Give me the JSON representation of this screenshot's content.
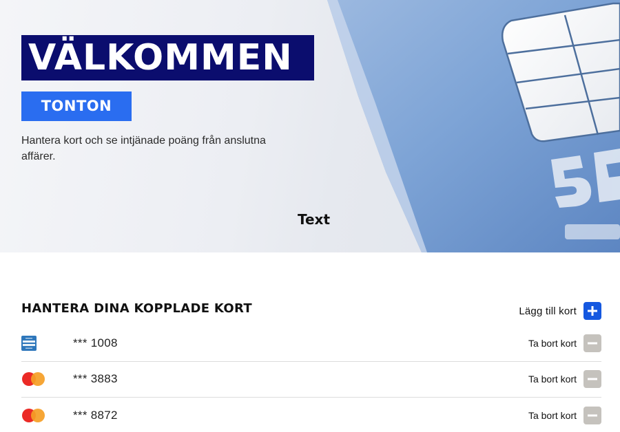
{
  "hero": {
    "title": "VÄLKOMMEN",
    "name": "TONTON",
    "description": "Hantera kort och se intjänade poäng från anslutna affärer.",
    "text_label": "Text"
  },
  "cards_section": {
    "title": "HANTERA DINA KOPPLADE KORT",
    "add_label": "Lägg till kort",
    "remove_label": "Ta bort kort",
    "cards": [
      {
        "brand": "american-express",
        "masked_number": "*** 1008"
      },
      {
        "brand": "mastercard",
        "masked_number": "*** 3883"
      },
      {
        "brand": "mastercard",
        "masked_number": "*** 8872"
      }
    ]
  },
  "colors": {
    "title_bar": "#0b0d6e",
    "name_box": "#2a6df0",
    "add_button": "#1558e0",
    "remove_button": "#c5c2bd",
    "mastercard_red": "#eb2a26",
    "mastercard_orange": "#f59e25",
    "amex_blue": "#2e77bb"
  },
  "icons": {
    "add": "plus-icon",
    "remove": "minus-icon"
  }
}
